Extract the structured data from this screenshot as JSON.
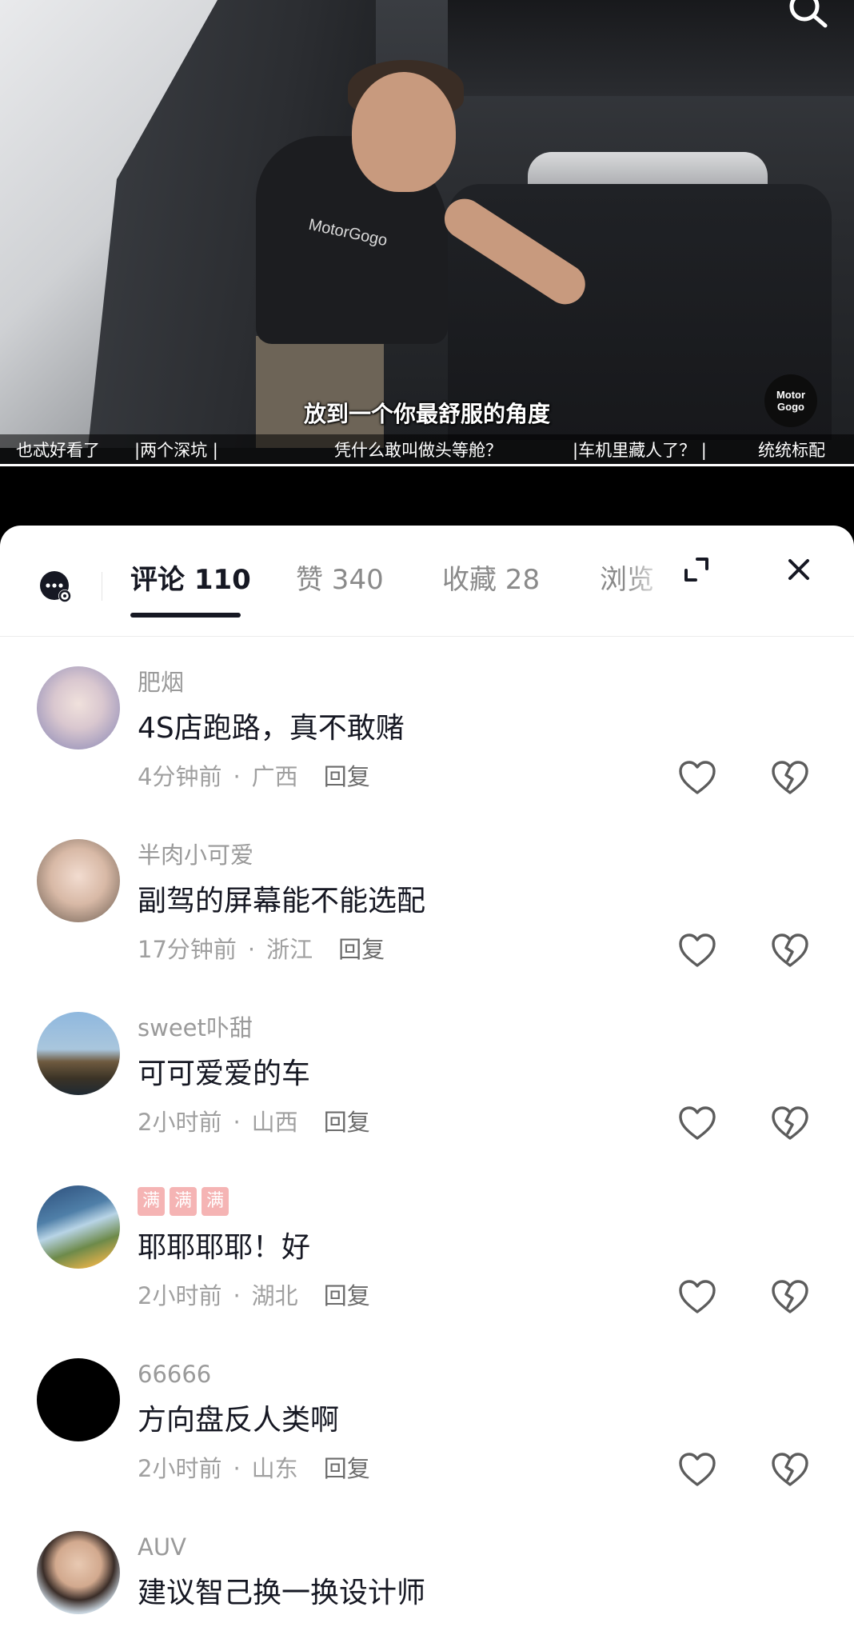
{
  "video": {
    "subtitle": "放到一个你最舒服的角度",
    "logo_line1": "Motor",
    "logo_line2": "Gogo",
    "chapters": [
      "也忒好看了",
      "|两个深坑 |",
      "凭什么敢叫做头等舱？",
      "|车机里藏人了？ |",
      "统统标配"
    ],
    "shirt_text": "MotorGogo"
  },
  "tabs": [
    {
      "label": "评论 110",
      "active": true
    },
    {
      "label": "赞 340",
      "active": false
    },
    {
      "label": "收藏 28",
      "active": false
    },
    {
      "label": "浏览",
      "active": false
    }
  ],
  "comments": [
    {
      "username": "肥烟",
      "text": "4S店跑路，真不敢赌",
      "time": "4分钟前",
      "location": "广西",
      "reply": "回复",
      "avatar_color": "#c9c3d6"
    },
    {
      "username": "半肉小可爱",
      "text": "副驾的屏幕能不能选配",
      "time": "17分钟前",
      "location": "浙江",
      "reply": "回复",
      "avatar_color": "#d8c2b0"
    },
    {
      "username": "sweet卟甜",
      "text": "可可爱爱的车",
      "time": "2小时前",
      "location": "山西",
      "reply": "回复",
      "avatar_color": "#7aa0c8"
    },
    {
      "badges": [
        "满",
        "满",
        "满"
      ],
      "text": "耶耶耶耶！好",
      "time": "2小时前",
      "location": "湖北",
      "reply": "回复",
      "avatar_color": "#4f7fa8"
    },
    {
      "username": "66666",
      "text": "方向盘反人类啊",
      "time": "2小时前",
      "location": "山东",
      "reply": "回复",
      "avatar_color": "#000000"
    },
    {
      "username": "AUV",
      "text": "建议智己换一换设计师",
      "avatar_color": "#c8d4de"
    }
  ],
  "meta_separator": "·",
  "icons": {
    "search": "search-icon",
    "ai": "ai-chat-icon",
    "expand": "expand-icon",
    "close": "close-icon",
    "like": "heart-icon",
    "dislike": "broken-heart-icon"
  }
}
